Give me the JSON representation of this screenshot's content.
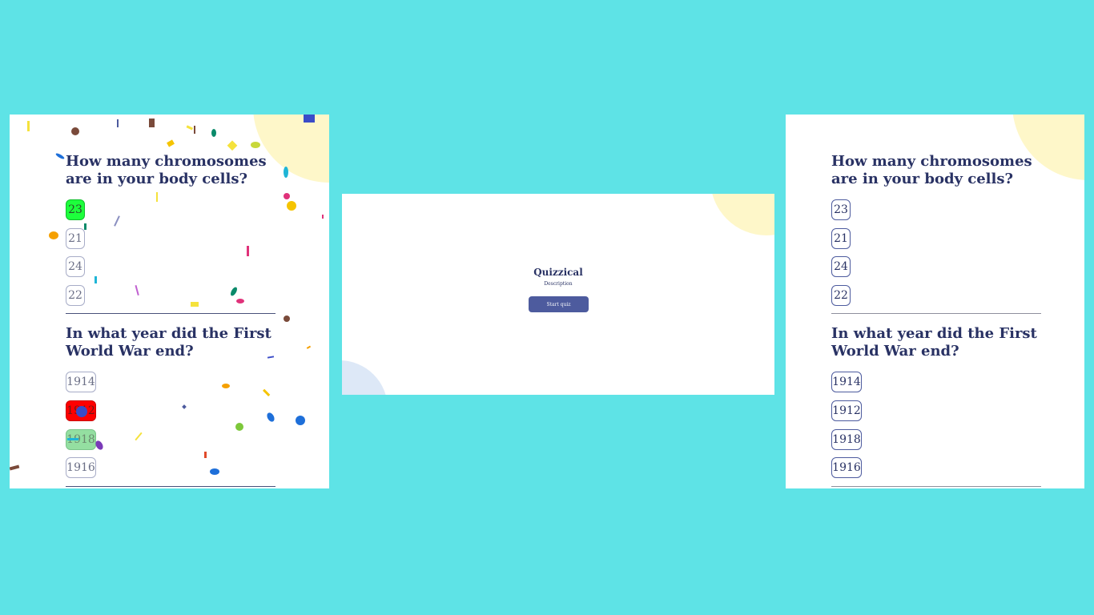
{
  "screens": {
    "result": {
      "questions": [
        {
          "text": "How many chromosomes are in your body cells?",
          "answers": [
            "23",
            "21",
            "24",
            "22"
          ]
        },
        {
          "text": "In what year did the First World War end?",
          "answers": [
            "1914",
            "1912",
            "1918",
            "1916"
          ]
        }
      ]
    },
    "start": {
      "title": "Quizzical",
      "description": "Description",
      "start_button": "Start quiz"
    },
    "quiz": {
      "questions": [
        {
          "text": "How many chromosomes are in your body cells?",
          "answers": [
            "23",
            "21",
            "24",
            "22"
          ]
        },
        {
          "text": "In what year did the First World War end?",
          "answers": [
            "1914",
            "1912",
            "1918",
            "1916"
          ]
        }
      ]
    }
  },
  "colors": {
    "background": "#5ee3e6",
    "primary_text": "#293264",
    "button": "#4d5b9e",
    "blob_yellow": "#fef7c9",
    "blob_blue": "#dde8f7",
    "selected_correct": "#1dff3c",
    "selected_wrong": "#ff0000",
    "revealed_correct": "#94dfa1"
  }
}
